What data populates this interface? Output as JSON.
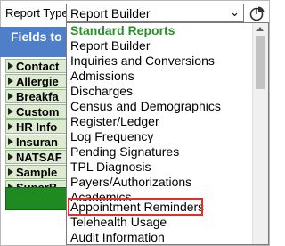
{
  "report_type": {
    "label": "Report Type:",
    "selected": "Report Builder",
    "arrow": "⌄"
  },
  "fields_panel": {
    "title": "Fields to I",
    "items": [
      "Contact",
      "Allergie",
      "Breakfa",
      "Custom",
      "HR Info",
      "Insuran",
      "NATSAF",
      "Sample",
      "SuperB"
    ]
  },
  "dropdown": {
    "group_label": "Standard Reports",
    "options": [
      "Report Builder",
      "Inquiries and Conversions",
      "Admissions",
      "Discharges",
      "Census and Demographics",
      "Register/Ledger",
      "Log Frequency",
      "Pending Signatures",
      "TPL Diagnosis",
      "Payers/Authorizations",
      "Academics",
      "Appointment Reminders",
      "Telehealth Usage",
      "Audit Information"
    ],
    "highlighted": "Appointment Reminders"
  },
  "colors": {
    "group_green": "#2e8b2e",
    "header_blue": "#4f7fc9",
    "highlight_red": "#e0302a",
    "field_green": "#ddecd0",
    "button_green": "#1f8a1f"
  },
  "icons": {
    "chart": "pie-chart-icon"
  }
}
